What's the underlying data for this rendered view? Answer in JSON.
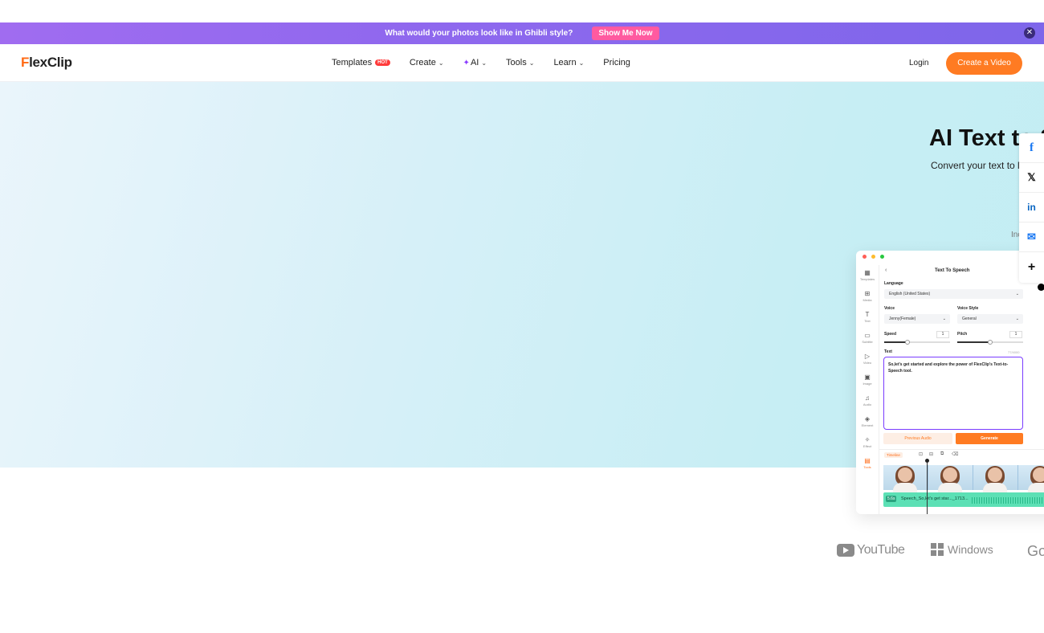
{
  "promo": {
    "text": "What would your photos look like in Ghibli style?",
    "button": "Show Me Now",
    "close_icon": "close-icon"
  },
  "logo": {
    "text": "FlexClip"
  },
  "nav": {
    "items": [
      {
        "label": "Templates",
        "badge": "HOT"
      },
      {
        "label": "Create"
      },
      {
        "label": "AI"
      },
      {
        "label": "Tools"
      },
      {
        "label": "Learn"
      },
      {
        "label": "Pricing"
      }
    ],
    "login": "Login",
    "cta": "Create a Video"
  },
  "hero": {
    "title": "AI Text to S",
    "subtitle": "Convert your text to lis",
    "small": "Inc"
  },
  "share": [
    "facebook-icon",
    "x-icon",
    "linkedin-icon",
    "mail-icon",
    "plus-icon"
  ],
  "app": {
    "panel_title": "Text To Speech",
    "language_label": "Language",
    "language_value": "English (United States)",
    "voice_label": "Voice",
    "voice_value": "Jenny(Female)",
    "voice_style_label": "Voice Style",
    "voice_style_value": "General",
    "speed_label": "Speed",
    "speed_value": "1",
    "pitch_label": "Pitch",
    "pitch_value": "1",
    "text_label": "Text",
    "char_count": "77/4000",
    "text_value": "So,let's get started and explore the power of FlexClip's Text-to-Speech tool.",
    "prev_button": "Previous Audio",
    "generate_button": "Generate",
    "timeline_label": "Timeline",
    "audio_duration": "5.6s",
    "audio_name": "Speech_So,let's get star..._1713...",
    "sidebar": [
      "Templates",
      "Media",
      "Text",
      "Subtitle",
      "Video",
      "Image",
      "Audio",
      "Element",
      "Effect",
      "Tools"
    ]
  },
  "logos": {
    "youtube": "YouTube",
    "windows": "Windows",
    "google": "Go"
  }
}
